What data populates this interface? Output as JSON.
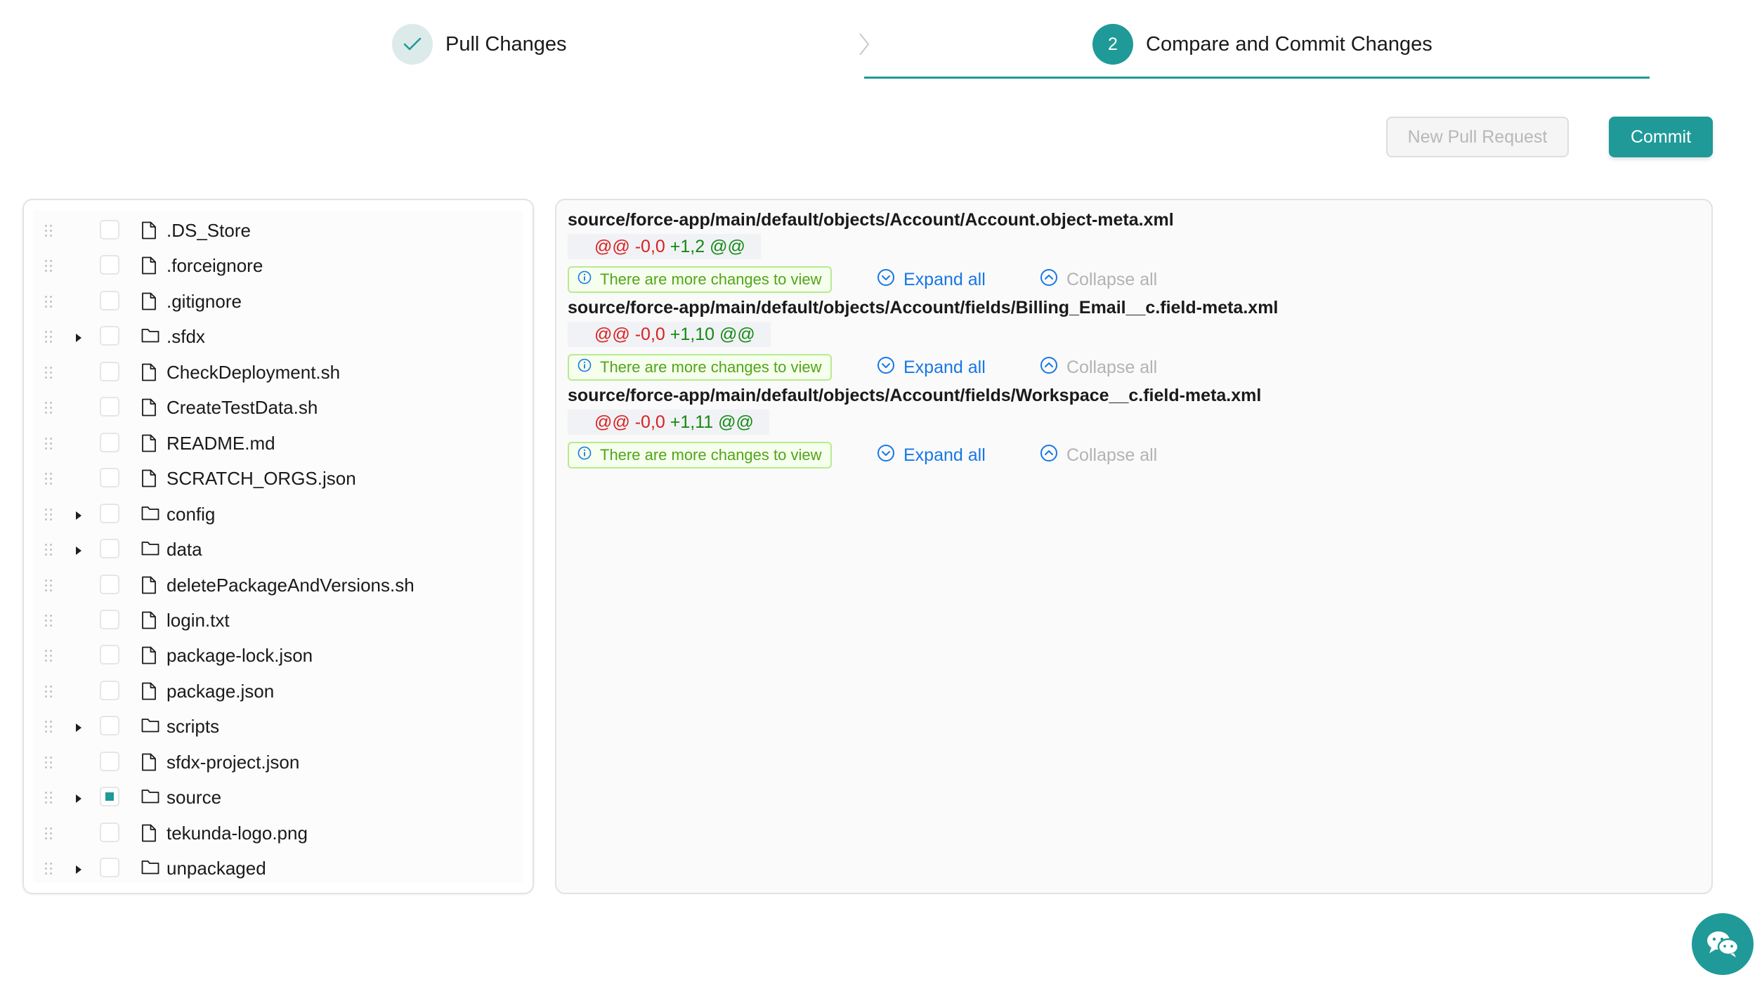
{
  "steps": [
    {
      "label": "Pull Changes",
      "status": "done"
    },
    {
      "label": "Compare and Commit Changes",
      "status": "active",
      "number": "2"
    }
  ],
  "actions": {
    "new_pull_request": "New Pull Request",
    "commit": "Commit"
  },
  "tree": [
    {
      "name": ".DS_Store",
      "kind": "file",
      "checked": false
    },
    {
      "name": ".forceignore",
      "kind": "file",
      "checked": false
    },
    {
      "name": ".gitignore",
      "kind": "file",
      "checked": false
    },
    {
      "name": ".sfdx",
      "kind": "folder",
      "checked": false
    },
    {
      "name": "CheckDeployment.sh",
      "kind": "file",
      "checked": false
    },
    {
      "name": "CreateTestData.sh",
      "kind": "file",
      "checked": false
    },
    {
      "name": "README.md",
      "kind": "file",
      "checked": false
    },
    {
      "name": "SCRATCH_ORGS.json",
      "kind": "file",
      "checked": false
    },
    {
      "name": "config",
      "kind": "folder",
      "checked": false
    },
    {
      "name": "data",
      "kind": "folder",
      "checked": false
    },
    {
      "name": "deletePackageAndVersions.sh",
      "kind": "file",
      "checked": false
    },
    {
      "name": "login.txt",
      "kind": "file",
      "checked": false
    },
    {
      "name": "package-lock.json",
      "kind": "file",
      "checked": false
    },
    {
      "name": "package.json",
      "kind": "file",
      "checked": false
    },
    {
      "name": "scripts",
      "kind": "folder",
      "checked": false
    },
    {
      "name": "sfdx-project.json",
      "kind": "file",
      "checked": false
    },
    {
      "name": "source",
      "kind": "folder",
      "checked": "partial"
    },
    {
      "name": "tekunda-logo.png",
      "kind": "file",
      "checked": false
    },
    {
      "name": "unpackaged",
      "kind": "folder",
      "checked": false
    }
  ],
  "diffs": [
    {
      "path": "source/force-app/main/default/objects/Account/Account.object-meta.xml",
      "hunk_prefix": "@@",
      "hunk_removed": "-0,0",
      "hunk_added": "+1,2",
      "hunk_suffix": "@@",
      "notice": "There are more changes to view",
      "expand": "Expand all",
      "collapse": "Collapse all"
    },
    {
      "path": "source/force-app/main/default/objects/Account/fields/Billing_Email__c.field-meta.xml",
      "hunk_prefix": "@@",
      "hunk_removed": "-0,0",
      "hunk_added": "+1,10",
      "hunk_suffix": "@@",
      "notice": "There are more changes to view",
      "expand": "Expand all",
      "collapse": "Collapse all"
    },
    {
      "path": "source/force-app/main/default/objects/Account/fields/Workspace__c.field-meta.xml",
      "hunk_prefix": "@@",
      "hunk_removed": "-0,0",
      "hunk_added": "+1,11",
      "hunk_suffix": "@@",
      "notice": "There are more changes to view",
      "expand": "Expand all",
      "collapse": "Collapse all"
    }
  ],
  "colors": {
    "accent": "#1f9a98",
    "link": "#1677e6",
    "removed": "#d92020",
    "added": "#128a12",
    "notice_text": "#52a41a"
  }
}
